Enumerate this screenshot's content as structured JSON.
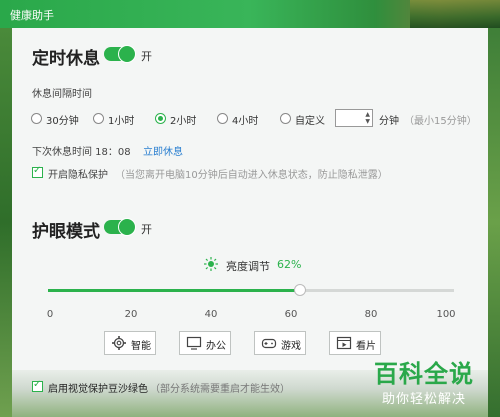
{
  "window": {
    "title": "健康助手"
  },
  "rest": {
    "title": "定时休息",
    "toggle_label": "开",
    "interval_label": "休息间隔时间",
    "options": [
      {
        "label": "30分钟",
        "selected": false
      },
      {
        "label": "1小时",
        "selected": false
      },
      {
        "label": "2小时",
        "selected": true
      },
      {
        "label": "4小时",
        "selected": false
      },
      {
        "label": "自定义",
        "selected": false
      }
    ],
    "custom_value": "",
    "custom_unit": "分钟",
    "custom_hint": "（最小15分钟）",
    "next_rest_label": "下次休息时间 18：08",
    "rest_now_link": "立即休息",
    "privacy_label": "开启隐私保护",
    "privacy_hint": "（当您离开电脑10分钟后自动进入休息状态，防止隐私泄露）"
  },
  "eye": {
    "title": "护眼模式",
    "toggle_label": "开",
    "brightness_label": "亮度调节",
    "brightness_value": "62%",
    "brightness_level": 62,
    "ticks": [
      "0",
      "20",
      "40",
      "60",
      "80",
      "100"
    ],
    "modes": [
      {
        "label": "智能",
        "icon": "gear-icon"
      },
      {
        "label": "办公",
        "icon": "monitor-icon"
      },
      {
        "label": "游戏",
        "icon": "gamepad-icon"
      },
      {
        "label": "看片",
        "icon": "film-icon"
      }
    ],
    "green_label": "启用视觉保护豆沙绿色",
    "green_hint": "（部分系统需要重启才能生效）"
  },
  "watermark": {
    "main": "百科全说",
    "sub": "助你轻松解决"
  },
  "colors": {
    "accent": "#2bb24c",
    "link": "#2a7fd0"
  }
}
